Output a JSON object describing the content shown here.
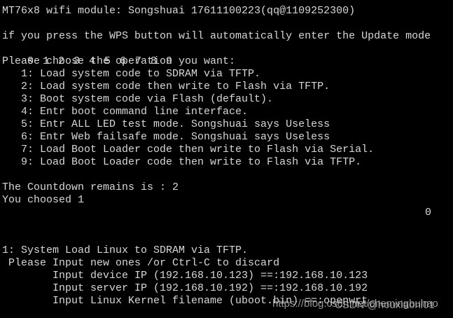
{
  "terminal": {
    "header": "MT76x8 wifi module: Songshuai 17611100223(qq@1109252300)",
    "wps_notice": "if you press the WPS button will automatically enter the Update mode",
    "digits": [
      "0",
      "1",
      "2",
      "3",
      "4",
      "5",
      "6",
      "7",
      "8",
      "9"
    ],
    "prompt": "Please choose the operation you want:",
    "options": [
      "   1: Load system code to SDRAM via TFTP.",
      "   2: Load system code then write to Flash via TFTP.",
      "   3: Boot system code via Flash (default).",
      "   4: Entr boot command line interface.",
      "   5: Entr ALL LED test mode. Songshuai says Useless",
      "   6: Entr Web failsafe mode. Songshuai says Useless",
      "   7: Load Boot Loader code then write to Flash via Serial.",
      "   9: Load Boot Loader code then write to Flash via TFTP."
    ],
    "countdown": "The Countdown remains is : 2",
    "chosen": "You choosed 1",
    "counter": "0",
    "action": "1: System Load Linux to SDRAM via TFTP.",
    "input_prompt": " Please Input new ones /or Ctrl-C to discard",
    "device_ip": "        Input device IP (192.168.10.123) ==:192.168.10.123",
    "server_ip": "        Input server IP (192.168.10.192) ==:192.168.10.192",
    "kernel": "        Input Linux Kernel filename (uboot.bin) ==:openwrt"
  },
  "watermark": {
    "url": "https://blog.csdn.net/chemingbuhao",
    "author": "CSDN @houxiaoni01"
  }
}
